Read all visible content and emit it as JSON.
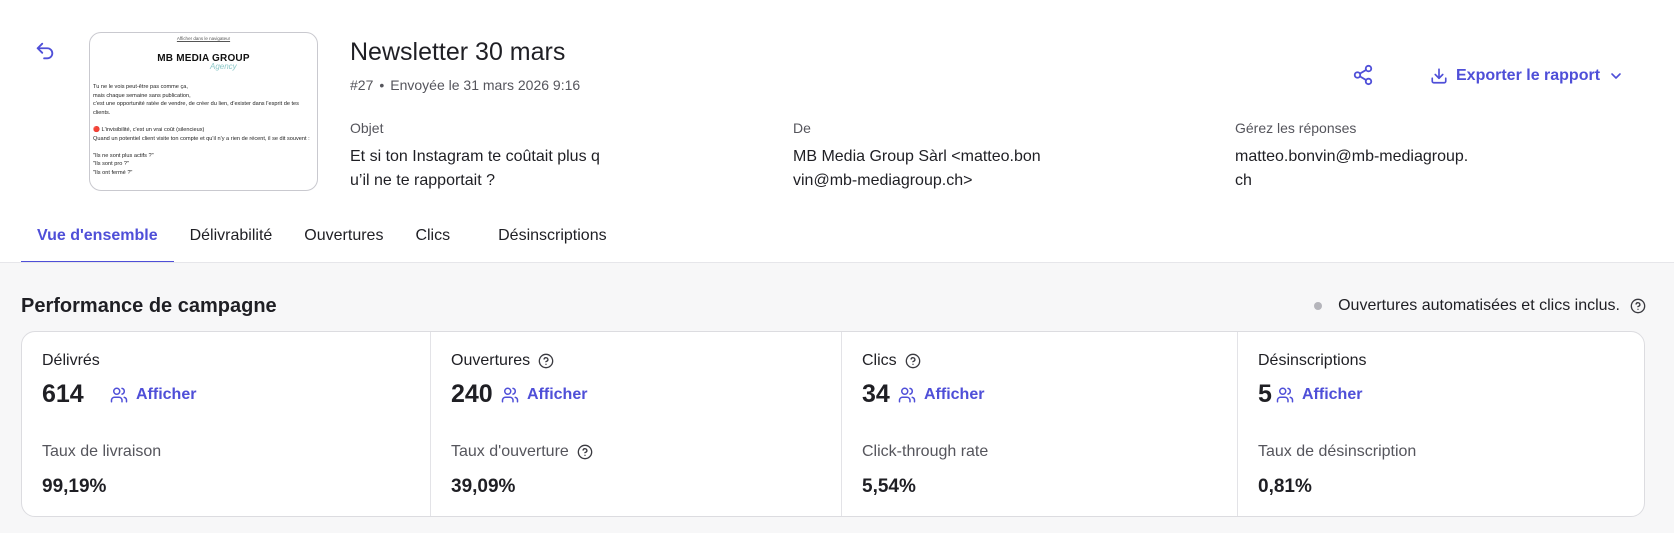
{
  "campaign": {
    "title": "Newsletter 30 mars",
    "number": "#27",
    "separator": "•",
    "sent": "Envoyée le 31 mars 2026 9:16"
  },
  "preview": {
    "link_text": "Afficher dans le navigateur",
    "logo_text": "MB MEDIA GROUP",
    "signature_text": "Agency",
    "body_text": "Tu ne le vois peut-être pas comme ça,\nmais chaque semaine sans publication,\nc'est une opportunité ratée de vendre, de créer du lien, d'exister dans l'esprit de tes clients.\n\n🔴 L'invisibilité, c'est un vrai coût (silencieux)\nQuand un potentiel client visite ton compte et qu'il n'y a rien de récent, il se dit souvent :\n\n\"Ils ne sont plus actifs ?\"\n\"Ils sont pro ?\"\n\"Ils ont fermé ?\""
  },
  "fields": {
    "subject": {
      "label": "Objet",
      "value": "Et si ton Instagram te coûtait plus qu’il ne te rapportait ?"
    },
    "from": {
      "label": "De",
      "value": "MB Media Group Sàrl <matteo.bonvin@mb-mediagroup.ch>"
    },
    "replies": {
      "label": "Gérez les réponses",
      "value": "matteo.bonvin@mb-mediagroup.ch"
    }
  },
  "actions": {
    "export_label": "Exporter le rapport"
  },
  "tabs": [
    {
      "label": "Vue d'ensemble",
      "active": true
    },
    {
      "label": "Délivrabilité",
      "active": false
    },
    {
      "label": "Ouvertures",
      "active": false
    },
    {
      "label": "Clics",
      "active": false
    },
    {
      "label": "Désinscriptions",
      "active": false
    }
  ],
  "performance": {
    "title": "Performance de campagne",
    "note": "Ouvertures automatisées et clics inclus.",
    "show_label": "Afficher",
    "cards": [
      {
        "label": "Délivrés",
        "value": "614",
        "rate_label": "Taux de livraison",
        "rate_value": "99,19%"
      },
      {
        "label": "Ouvertures",
        "value": "240",
        "rate_label": "Taux d'ouverture",
        "rate_value": "39,09%"
      },
      {
        "label": "Clics",
        "value": "34",
        "rate_label": "Click-through rate",
        "rate_value": "5,54%"
      },
      {
        "label": "Désinscriptions",
        "value": "5",
        "rate_label": "Taux de désinscription",
        "rate_value": "0,81%"
      }
    ]
  },
  "colors": {
    "accent": "#4f4fd8",
    "text": "#1f1f24",
    "muted": "#55555c",
    "section_bg": "#f7f7f8"
  }
}
